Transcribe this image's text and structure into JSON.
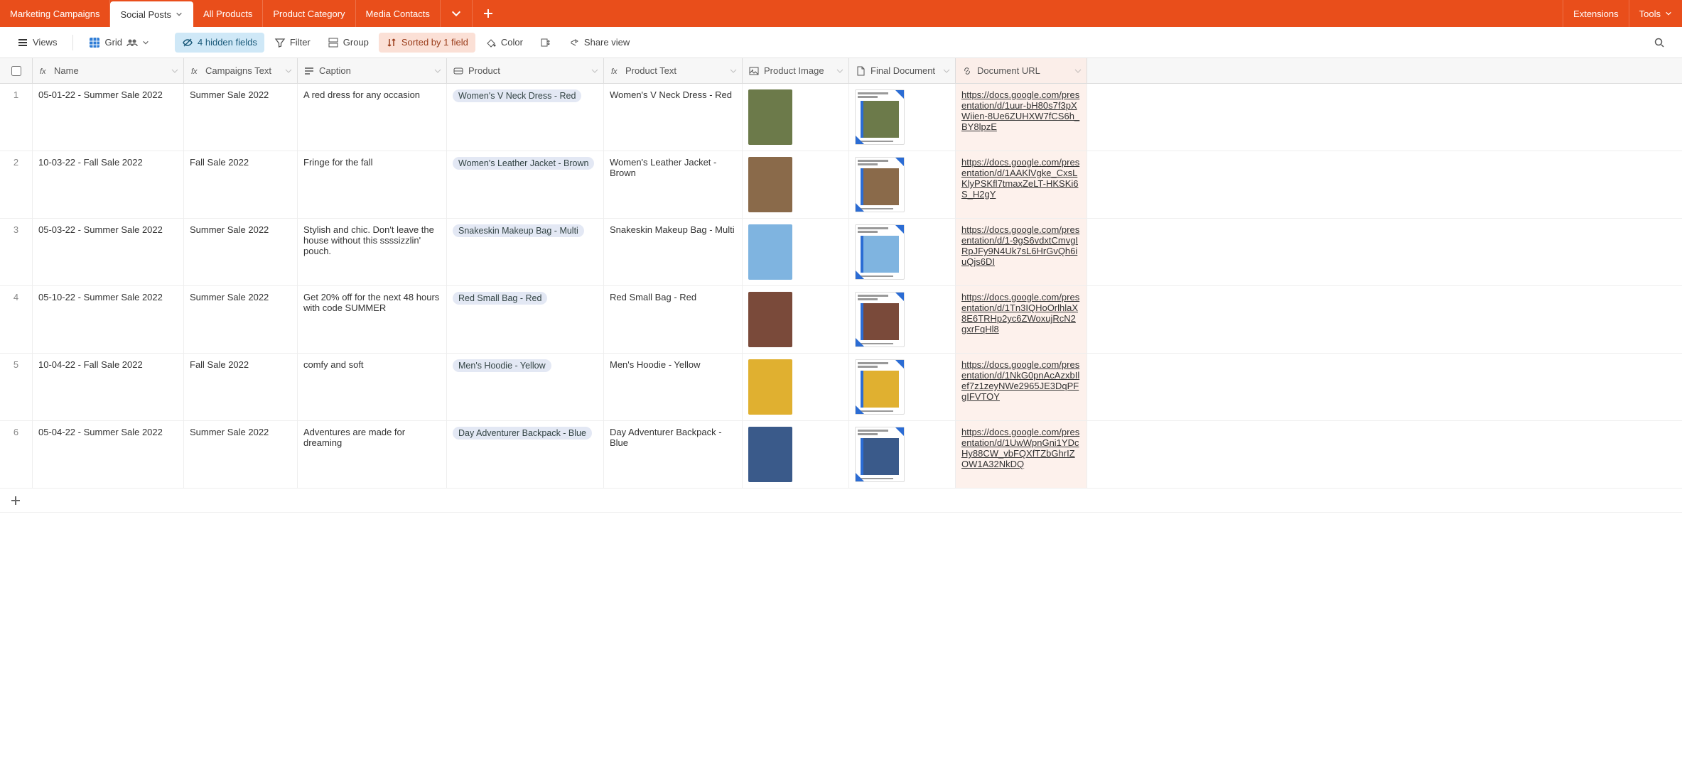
{
  "tabs": {
    "items": [
      {
        "label": "Marketing Campaigns",
        "active": false,
        "has_dropdown": false
      },
      {
        "label": "Social Posts",
        "active": true,
        "has_dropdown": true
      },
      {
        "label": "All Products",
        "active": false,
        "has_dropdown": false
      },
      {
        "label": "Product Category",
        "active": false,
        "has_dropdown": false
      },
      {
        "label": "Media Contacts",
        "active": false,
        "has_dropdown": false
      }
    ],
    "right": {
      "extensions": "Extensions",
      "tools": "Tools"
    }
  },
  "toolbar": {
    "views": "Views",
    "grid": "Grid",
    "hidden_fields": "4 hidden fields",
    "filter": "Filter",
    "group": "Group",
    "sorted": "Sorted by 1 field",
    "color": "Color",
    "share": "Share view"
  },
  "columns": [
    {
      "key": "name",
      "label": "Name",
      "type": "formula"
    },
    {
      "key": "campaigns",
      "label": "Campaigns Text",
      "type": "formula"
    },
    {
      "key": "caption",
      "label": "Caption",
      "type": "longtext"
    },
    {
      "key": "product",
      "label": "Product",
      "type": "link"
    },
    {
      "key": "product_text",
      "label": "Product Text",
      "type": "formula"
    },
    {
      "key": "product_image",
      "label": "Product Image",
      "type": "attachment"
    },
    {
      "key": "final_doc",
      "label": "Final Document",
      "type": "attachment"
    },
    {
      "key": "doc_url",
      "label": "Document URL",
      "type": "url"
    }
  ],
  "rows": [
    {
      "num": "1",
      "name": "05-01-22 - Summer Sale 2022",
      "campaigns": "Summer Sale 2022",
      "caption": "A red dress for any occasion",
      "product": "Women's V Neck Dress - Red",
      "product_text": "Women's V Neck Dress - Red",
      "doc_url": "https://docs.google.com/presentation/d/1uur-bH80s7f3pXWiien-8Ue6ZUHXW7fCS6h_BY8lpzE",
      "img_color": "#6c7a4a",
      "doc_title_a": "Women's V Neck",
      "doc_title_b": "Dress – Red"
    },
    {
      "num": "2",
      "name": "10-03-22 - Fall Sale 2022",
      "campaigns": "Fall Sale 2022",
      "caption": "Fringe for the fall",
      "product": "Women's Leather Jacket - Brown",
      "product_text": "Women's Leather Jacket - Brown",
      "doc_url": "https://docs.google.com/presentation/d/1AAKlVgke_CxsLKlyPSKfl7tmaxZeLT-HKSKi6S_H2gY",
      "img_color": "#8a6a4a",
      "doc_title_a": "Women's Leather",
      "doc_title_b": "Jacket – Brown"
    },
    {
      "num": "3",
      "name": "05-03-22 - Summer Sale 2022",
      "campaigns": "Summer Sale 2022",
      "caption": "Stylish and chic. Don't leave the house without this ssssizzlin' pouch.",
      "product": "Snakeskin Makeup Bag - Multi",
      "product_text": "Snakeskin Makeup Bag - Multi",
      "doc_url": "https://docs.google.com/presentation/d/1-9gS6vdxtCmvgIRpJFy9N4Uk7sL6HrGvQh6iuQjs6DI",
      "img_color": "#7fb4e0",
      "doc_title_a": "Snakeskin Makeup",
      "doc_title_b": "Bag – Multi"
    },
    {
      "num": "4",
      "name": "05-10-22 - Summer Sale 2022",
      "campaigns": "Summer Sale 2022",
      "caption": "Get 20% off for the next 48 hours with code SUMMER",
      "product": "Red Small Bag - Red",
      "product_text": "Red Small Bag - Red",
      "doc_url": "https://docs.google.com/presentation/d/1Tn3IQHoOrlhlaX8E6TRHp2yc6ZWoxujRcN2gxrFqHl8",
      "img_color": "#7a4a3a",
      "doc_title_a": "Red Small Bag – Red",
      "doc_title_b": ""
    },
    {
      "num": "5",
      "name": "10-04-22 - Fall Sale 2022",
      "campaigns": "Fall Sale 2022",
      "caption": "comfy and soft",
      "product": "Men's Hoodie - Yellow",
      "product_text": "Men's Hoodie - Yellow",
      "doc_url": "https://docs.google.com/presentation/d/1NkG0pnAcAzxbIlef7z1zeyNWe2965JE3DqPFgIFVTOY",
      "img_color": "#e0b030",
      "doc_title_a": "Men's Hoodie – Yellow",
      "doc_title_b": ""
    },
    {
      "num": "6",
      "name": "05-04-22 - Summer Sale 2022",
      "campaigns": "Summer Sale 2022",
      "caption": "Adventures are made for dreaming",
      "product": "Day Adventurer Backpack - Blue",
      "product_text": "Day Adventurer Backpack - Blue",
      "doc_url": "https://docs.google.com/presentation/d/1UwWpnGni1YDcHy88CW_vbFQXfTZbGhrIZOW1A32NkDQ",
      "img_color": "#3a5a8a",
      "doc_title_a": "Day Adventurer",
      "doc_title_b": "Backpack – Blue"
    }
  ]
}
